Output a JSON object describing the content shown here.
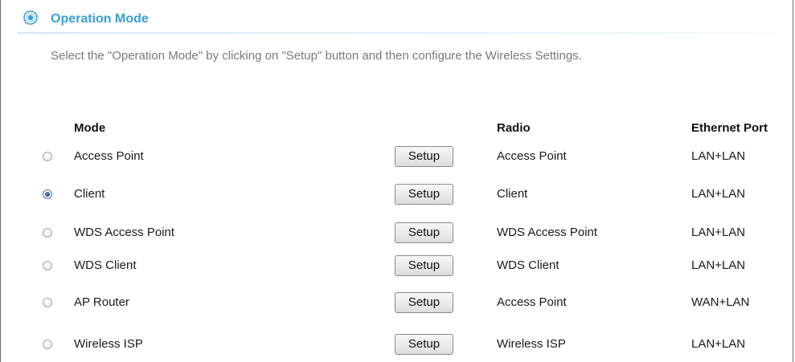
{
  "section": {
    "title": "Operation Mode",
    "icon": "target-icon",
    "accent_color": "#3a9fd5",
    "description": "Select the \"Operation Mode\" by clicking on \"Setup\" button and then configure the Wireless Settings."
  },
  "table": {
    "headers": {
      "mode": "Mode",
      "radio": "Radio",
      "ethernet": "Ethernet Port"
    },
    "rows": [
      {
        "mode": "Access Point",
        "button": "Setup",
        "radio": "Access Point",
        "ethernet": "LAN+LAN",
        "selected": false
      },
      {
        "mode": "Client",
        "button": "Setup",
        "radio": "Client",
        "ethernet": "LAN+LAN",
        "selected": true
      },
      {
        "mode": "WDS Access Point",
        "button": "Setup",
        "radio": "WDS Access Point",
        "ethernet": "LAN+LAN",
        "selected": false
      },
      {
        "mode": "WDS Client",
        "button": "Setup",
        "radio": "WDS Client",
        "ethernet": "LAN+LAN",
        "selected": false
      },
      {
        "mode": "AP Router",
        "button": "Setup",
        "radio": "Access Point",
        "ethernet": "WAN+LAN",
        "selected": false
      },
      {
        "mode": "Wireless ISP",
        "button": "Setup",
        "radio": "Wireless ISP",
        "ethernet": "LAN+LAN",
        "selected": false
      }
    ]
  }
}
